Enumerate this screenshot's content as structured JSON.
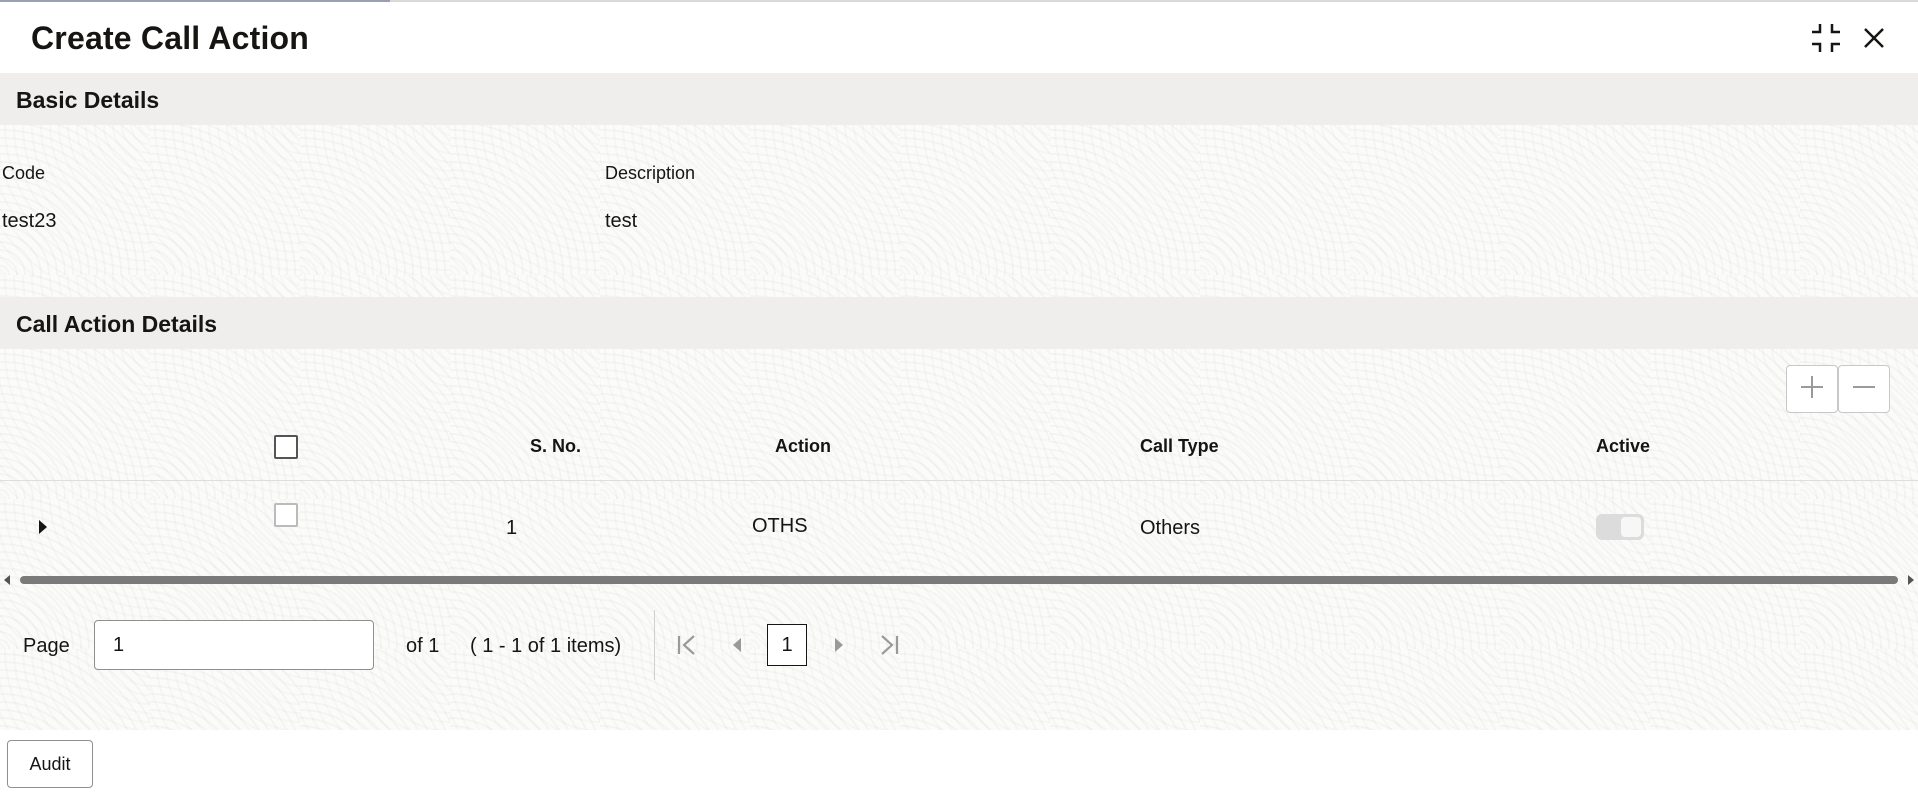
{
  "dialog": {
    "title": "Create Call Action"
  },
  "header_icons": {
    "minimize": "collapse-icon",
    "close": "close-icon"
  },
  "basic_details": {
    "section_title": "Basic Details",
    "code_label": "Code",
    "code_value": "test23",
    "description_label": "Description",
    "description_value": "test"
  },
  "call_action_details": {
    "section_title": "Call Action Details",
    "toolbar": {
      "add_icon": "plus-icon",
      "remove_icon": "minus-icon"
    },
    "columns": [
      "S. No.",
      "Action",
      "Call Type",
      "Active"
    ],
    "rows": [
      {
        "sno": "1",
        "action": "OTHS",
        "call_type": "Others",
        "active": true
      }
    ]
  },
  "pagination": {
    "page_label": "Page",
    "page_value": "1",
    "of_text": "of 1",
    "items_text": "( 1 - 1 of 1 items)",
    "current_page": "1"
  },
  "footer": {
    "audit_label": "Audit"
  }
}
